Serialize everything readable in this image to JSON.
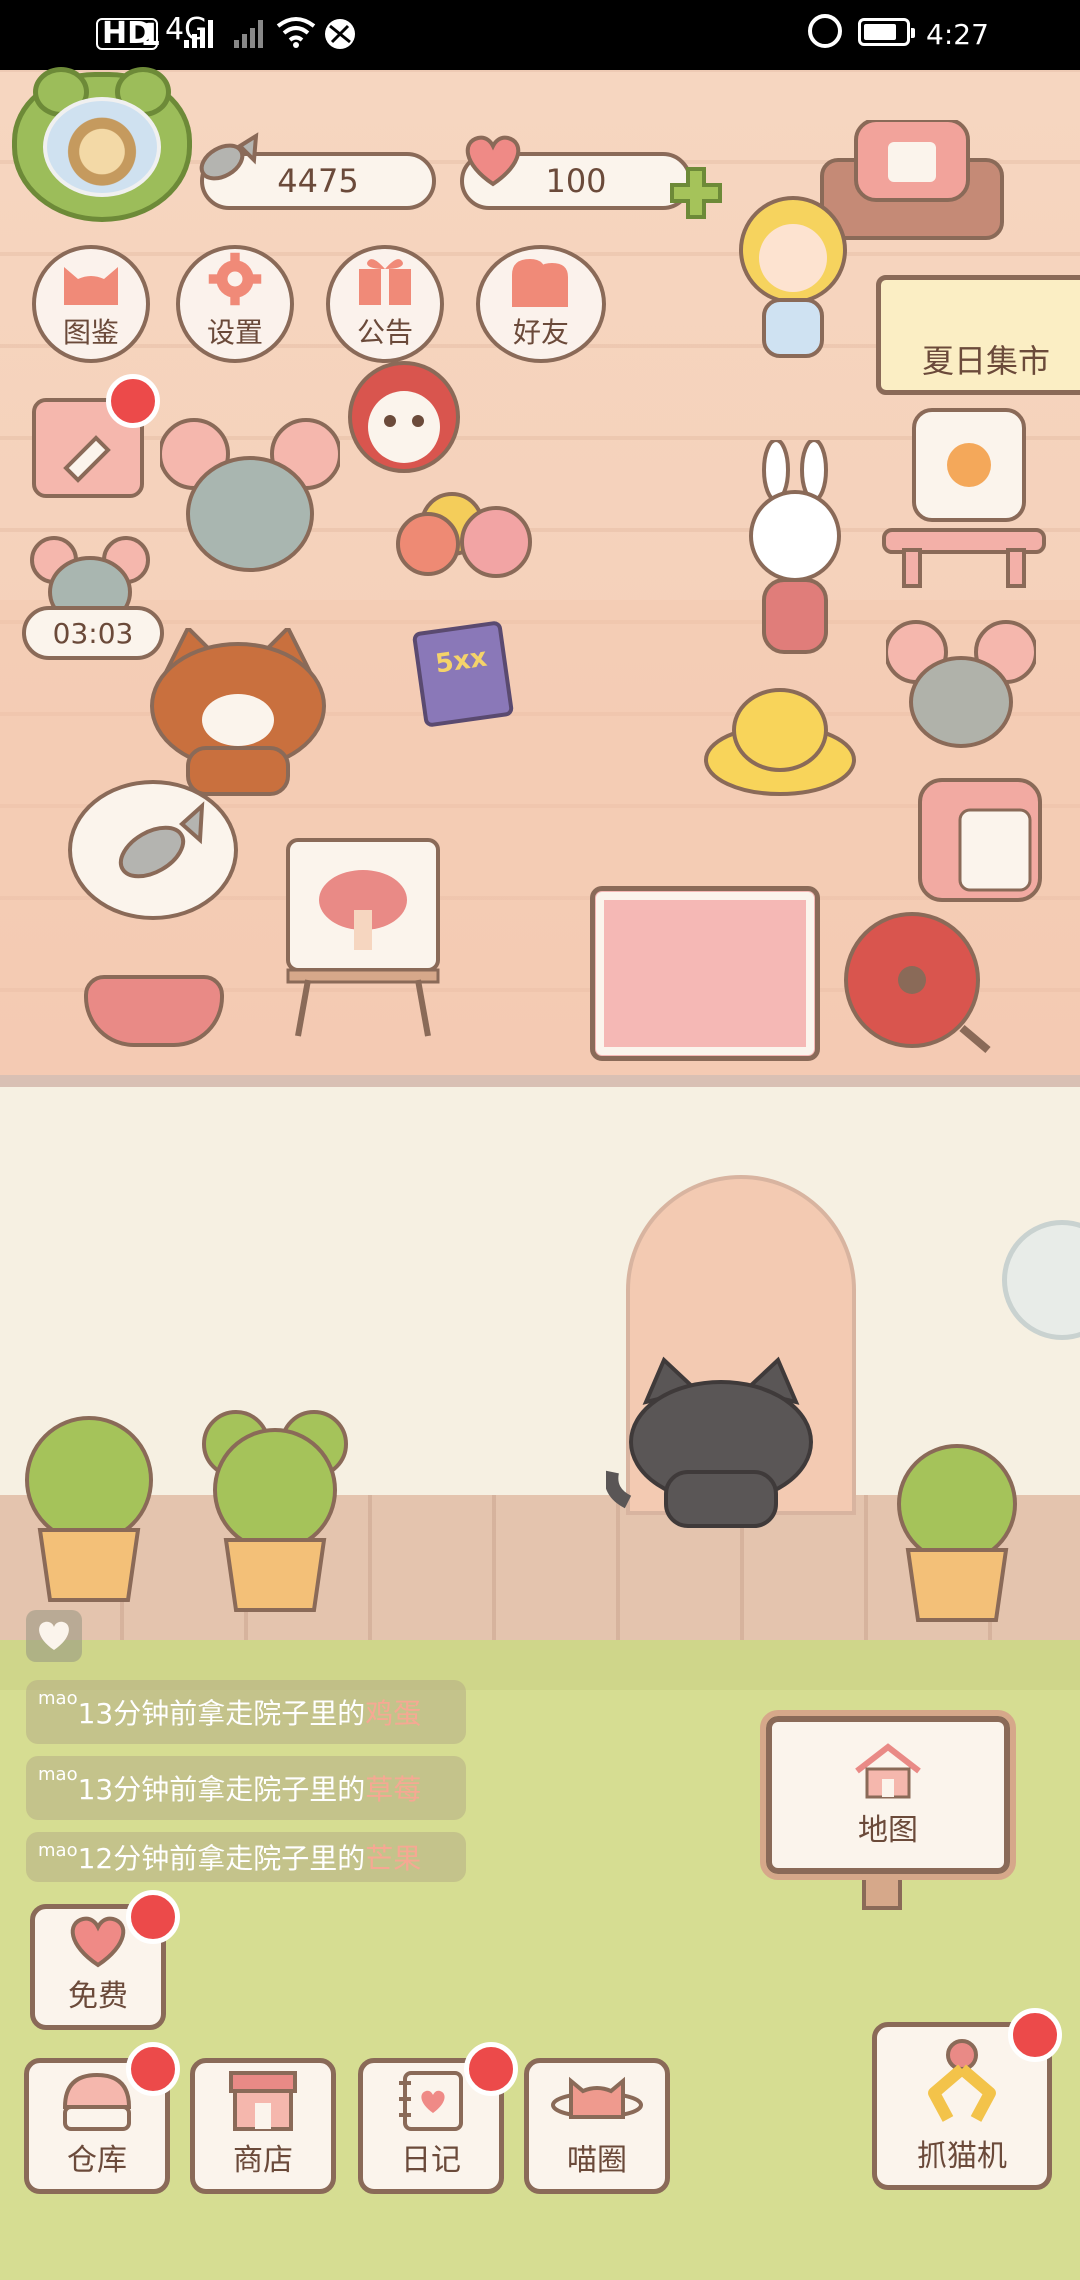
{
  "status_bar": {
    "network_hd": "HD",
    "sim_slot": "1",
    "network_type": "4G",
    "time": "4:27",
    "icons": [
      "signal-icon",
      "no-signal-icon",
      "wifi-icon",
      "nfc-icon",
      "alarm-icon",
      "battery-icon"
    ]
  },
  "currency": {
    "fish_count": "4475",
    "heart_count": "100"
  },
  "menu": {
    "atlas": "图鉴",
    "settings": "设置",
    "notice": "公告",
    "friends": "好友"
  },
  "event_sign": "夏日集市",
  "timer": "03:03",
  "book_label": "5xx",
  "feed": [
    {
      "user": "mao",
      "text": "13分钟前拿走院子里的",
      "item": "鸡蛋"
    },
    {
      "user": "mao",
      "text": "13分钟前拿走院子里的",
      "item": "草莓"
    },
    {
      "user": "mao",
      "text": "12分钟前拿走院子里的",
      "item": "芒果"
    }
  ],
  "buttons": {
    "map": "地图",
    "free": "免费",
    "warehouse": "仓库",
    "shop": "商店",
    "diary": "日记",
    "cat_circle": "喵圈",
    "claw_machine": "抓猫机"
  },
  "colors": {
    "room_wall": "#f6d6c0",
    "grass": "#d6dd92",
    "notification_dot": "#ec4a4a",
    "outline": "#8a6a58"
  }
}
